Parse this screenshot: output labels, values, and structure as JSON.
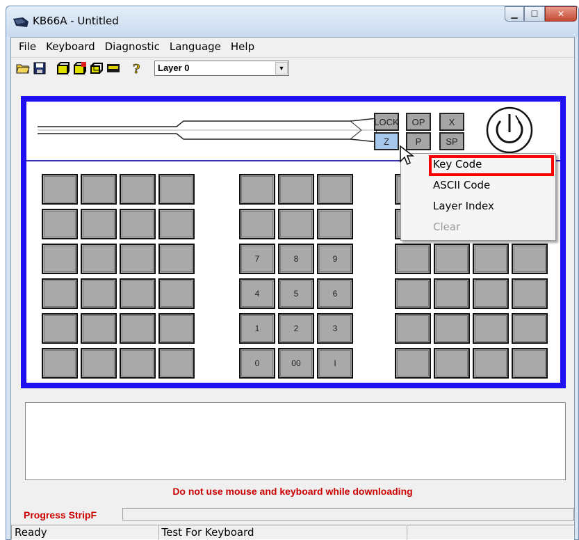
{
  "window": {
    "title": "KB66A - Untitled"
  },
  "menu": [
    "File",
    "Keyboard",
    "Diagnostic",
    "Language",
    "Help"
  ],
  "toolbar": {
    "layer_select_value": "Layer 0",
    "icons": [
      "open-folder-icon",
      "save-icon",
      "new-key-icon",
      "edit-key-icon",
      "layer-icon",
      "bar-icon",
      "help-icon"
    ]
  },
  "keyboard": {
    "top_keys": [
      "LOCK",
      "OP",
      "X",
      "Z",
      "P",
      "SP"
    ],
    "numpad": [
      "7",
      "8",
      "9",
      "4",
      "5",
      "6",
      "1",
      "2",
      "3",
      "0",
      "00",
      "I"
    ]
  },
  "context_menu": {
    "items": [
      "Key Code",
      "ASCII Code",
      "Layer Index",
      "Clear"
    ],
    "highlighted": "Key Code"
  },
  "messages": {
    "warning": "Do not use mouse and keyboard while downloading",
    "progress_label": "Progress StripF"
  },
  "status": {
    "pane1": "Ready",
    "pane2": "Test For Keyboard",
    "pane3": ""
  },
  "colors": {
    "panel_border": "#1e10f0",
    "warning_text": "#cc0000",
    "highlight_box": "#ff0000",
    "selected_key": "#a7c7ea"
  }
}
